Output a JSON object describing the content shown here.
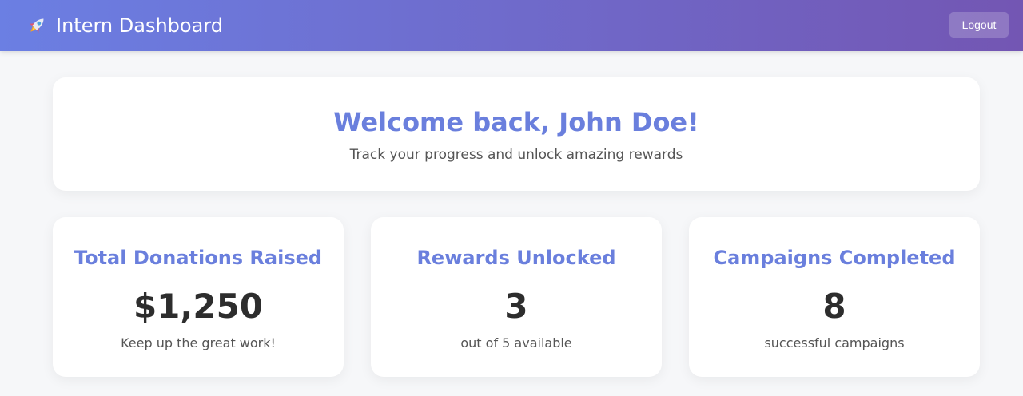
{
  "header": {
    "app_title": "Intern Dashboard",
    "logout_label": "Logout",
    "brand_icon": "rocket-icon"
  },
  "welcome": {
    "title": "Welcome back, John Doe!",
    "subtitle": "Track your progress and unlock amazing rewards"
  },
  "stats": [
    {
      "title": "Total Donations Raised",
      "value": "$1,250",
      "note": "Keep up the great work!"
    },
    {
      "title": "Rewards Unlocked",
      "value": "3",
      "note": "out of 5 available"
    },
    {
      "title": "Campaigns Completed",
      "value": "8",
      "note": "successful campaigns"
    }
  ],
  "colors": {
    "header_gradient_start": "#6b7fe3",
    "header_gradient_end": "#7356b3",
    "accent": "#6a7fdd",
    "value_text": "#2d2d2d"
  }
}
